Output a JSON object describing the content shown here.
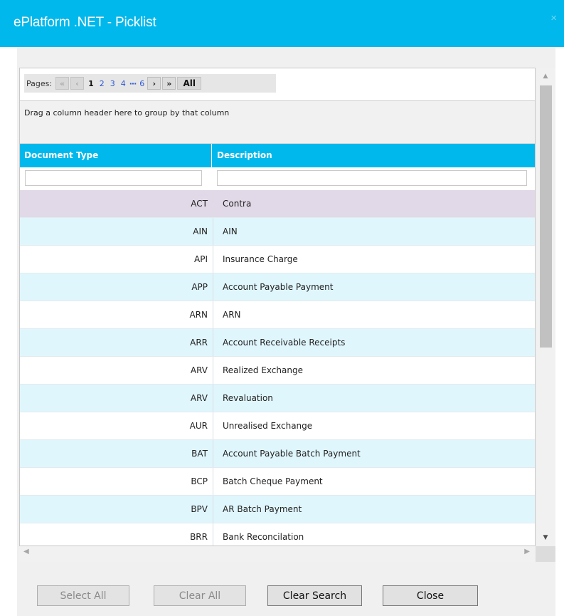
{
  "window": {
    "title": "ePlatform .NET - Picklist",
    "close_glyph": "×"
  },
  "pager": {
    "label": "Pages:",
    "first": "«",
    "prev": "‹",
    "pages": [
      "1",
      "2",
      "3",
      "4"
    ],
    "current_page": "1",
    "ellipsis": "···",
    "last_page": "6",
    "next": "›",
    "last": "»",
    "all": "All"
  },
  "group_panel": {
    "text": "Drag a column header here to group by that column"
  },
  "columns": {
    "doc_type": "Document Type",
    "description": "Description"
  },
  "filters": {
    "doc_type_value": "",
    "description_value": ""
  },
  "rows": [
    {
      "code": "ACT",
      "desc": "Contra"
    },
    {
      "code": "AIN",
      "desc": "AIN"
    },
    {
      "code": "API",
      "desc": "Insurance Charge"
    },
    {
      "code": "APP",
      "desc": "Account Payable Payment"
    },
    {
      "code": "ARN",
      "desc": "ARN"
    },
    {
      "code": "ARR",
      "desc": "Account Receivable Receipts"
    },
    {
      "code": "ARV",
      "desc": "Realized Exchange"
    },
    {
      "code": "ARV",
      "desc": "Revaluation"
    },
    {
      "code": "AUR",
      "desc": "Unrealised Exchange"
    },
    {
      "code": "BAT",
      "desc": "Account Payable Batch Payment"
    },
    {
      "code": "BCP",
      "desc": "Batch Cheque Payment"
    },
    {
      "code": "BPV",
      "desc": "AR Batch Payment"
    },
    {
      "code": "BRR",
      "desc": "Bank Reconcilation"
    }
  ],
  "selected_row_index": 0,
  "footer": {
    "select_all": "Select All",
    "clear_all": "Clear All",
    "clear_search": "Clear Search",
    "close": "Close"
  },
  "colors": {
    "accent": "#00b8ec",
    "row_alt": "#e0f6fd",
    "row_selected": "#e1d9e7"
  }
}
